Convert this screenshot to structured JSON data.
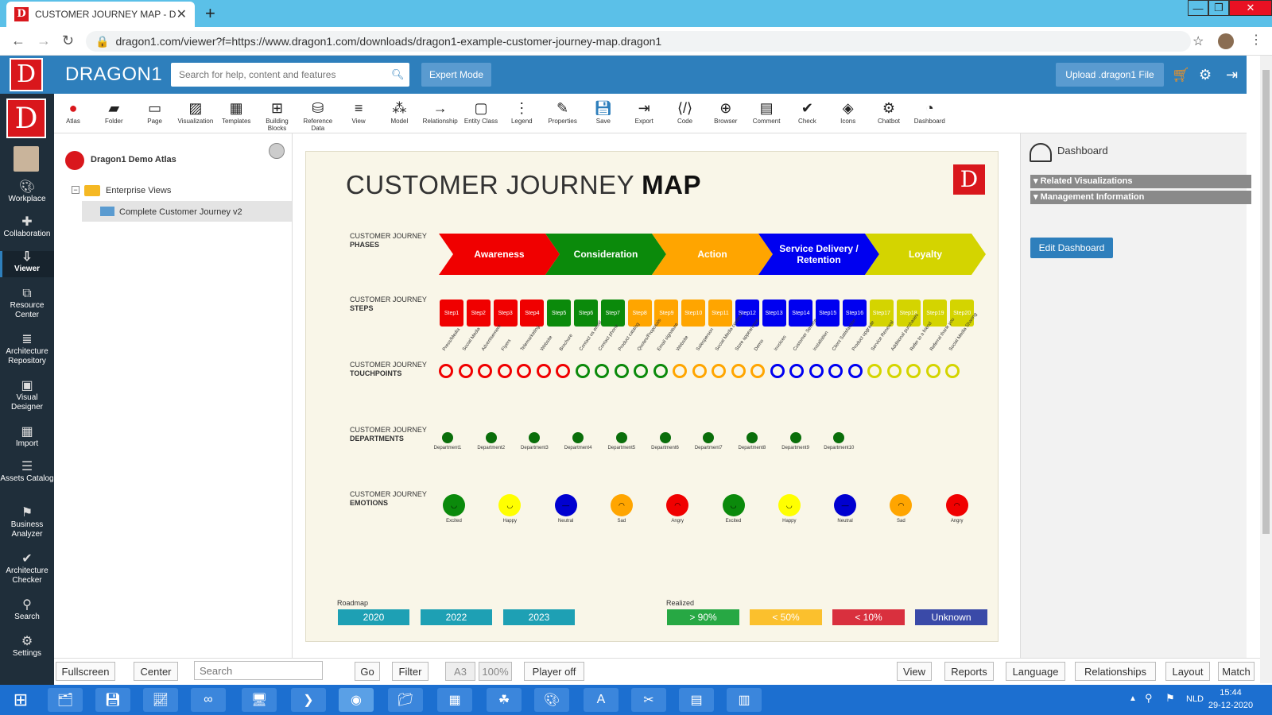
{
  "browser": {
    "tab_title": "CUSTOMER JOURNEY MAP - Dra",
    "url": "dragon1.com/viewer?f=https://www.dragon1.com/downloads/dragon1-example-customer-journey-map.dragon1"
  },
  "header": {
    "brand": "DRAGON1",
    "search_placeholder": "Search for help, content and features",
    "expert_mode": "Expert Mode",
    "upload": "Upload .dragon1 File"
  },
  "left_nav": [
    {
      "label": "Workplace",
      "icon": "palette-icon"
    },
    {
      "label": "Collaboration",
      "icon": "puzzle-icon"
    },
    {
      "label": "Viewer",
      "icon": "viewer-icon"
    },
    {
      "label": "Resource Center",
      "icon": "resource-icon"
    },
    {
      "label": "Architecture Repository",
      "icon": "database-icon"
    },
    {
      "label": "Visual Designer",
      "icon": "image-icon"
    },
    {
      "label": "Import",
      "icon": "table-icon"
    },
    {
      "label": "Assets Catalog",
      "icon": "list-icon"
    },
    {
      "label": "Business Analyzer",
      "icon": "flag-icon"
    },
    {
      "label": "Architecture Checker",
      "icon": "check-icon"
    },
    {
      "label": "Search",
      "icon": "search-icon"
    },
    {
      "label": "Settings",
      "icon": "gear-icon"
    }
  ],
  "toolbar": [
    "Atlas",
    "Folder",
    "Page",
    "Visualization",
    "Templates",
    "Building Blocks",
    "Reference Data",
    "View",
    "Model",
    "Relationship",
    "Entity Class",
    "Legend",
    "Properties",
    "Save",
    "Export",
    "Code",
    "Browser",
    "Comment",
    "Check",
    "Icons",
    "Chatbot",
    "Dashboard"
  ],
  "tree": {
    "atlas": "Dragon1 Demo Atlas",
    "folder": "Enterprise Views",
    "item": "Complete Customer Journey v2"
  },
  "map": {
    "title_light": "CUSTOMER JOURNEY ",
    "title_bold": "MAP",
    "row_prefix": "CUSTOMER JOURNEY",
    "rows": [
      "PHASES",
      "STEPS",
      "TOUCHPOINTS",
      "DEPARTMENTS",
      "EMOTIONS"
    ],
    "phases": [
      {
        "label": "Awareness",
        "color": "#f00000"
      },
      {
        "label": "Consideration",
        "color": "#0b8a0b"
      },
      {
        "label": "Action",
        "color": "#ffa500"
      },
      {
        "label": "Service Delivery / Retention",
        "color": "#0000f0"
      },
      {
        "label": "Loyalty",
        "color": "#d4d400"
      }
    ],
    "steps": [
      "Step1",
      "Step2",
      "Step3",
      "Step4",
      "Step5",
      "Step6",
      "Step7",
      "Step8",
      "Step9",
      "Step10",
      "Step11",
      "Step12",
      "Step13",
      "Step14",
      "Step15",
      "Step16",
      "Step17",
      "Step18",
      "Step19",
      "Step20"
    ],
    "step_colors": [
      "#f00000",
      "#f00000",
      "#f00000",
      "#f00000",
      "#0b8a0b",
      "#0b8a0b",
      "#0b8a0b",
      "#ffa500",
      "#ffa500",
      "#ffa500",
      "#ffa500",
      "#0000f0",
      "#0000f0",
      "#0000f0",
      "#0000f0",
      "#0000f0",
      "#d4d400",
      "#d4d400",
      "#d4d400",
      "#d4d400"
    ],
    "touchpoints": [
      "Press/Media",
      "Social Media",
      "Advertisement",
      "Flyers",
      "Telemarketing",
      "Website",
      "Brochure",
      "Contact us email",
      "Contact phone",
      "Product catalog",
      "Quotes/Proposals",
      "Email signature",
      "Website",
      "Salesperson",
      "Social Media contest",
      "Store appearance",
      "Demo",
      "Invoices",
      "Customer Service",
      "Installation",
      "Client Satisfaction",
      "Product upgrade",
      "Service Renewal",
      "Additional purchases",
      "Refer to a friend",
      "Referral thank you",
      "Social Media Sharing"
    ],
    "touchpoint_colors": [
      "#f00000",
      "#f00000",
      "#f00000",
      "#f00000",
      "#f00000",
      "#f00000",
      "#f00000",
      "#0b8a0b",
      "#0b8a0b",
      "#0b8a0b",
      "#0b8a0b",
      "#0b8a0b",
      "#ffa500",
      "#ffa500",
      "#ffa500",
      "#ffa500",
      "#ffa500",
      "#0000f0",
      "#0000f0",
      "#0000f0",
      "#0000f0",
      "#0000f0",
      "#d4d400",
      "#d4d400",
      "#d4d400",
      "#d4d400",
      "#d4d400"
    ],
    "departments": [
      "Department1",
      "Department2",
      "Department3",
      "Department4",
      "Department5",
      "Department6",
      "Department7",
      "Department8",
      "Department9",
      "Department10"
    ],
    "emotions": [
      {
        "label": "Excited",
        "color": "#0b8a0b"
      },
      {
        "label": "Happy",
        "color": "#ffff00"
      },
      {
        "label": "Neutral",
        "color": "#0000d0"
      },
      {
        "label": "Sad",
        "color": "#ffa500"
      },
      {
        "label": "Angry",
        "color": "#f00000"
      },
      {
        "label": "Excited",
        "color": "#0b8a0b"
      },
      {
        "label": "Happy",
        "color": "#ffff00"
      },
      {
        "label": "Neutral",
        "color": "#0000d0"
      },
      {
        "label": "Sad",
        "color": "#ffa500"
      },
      {
        "label": "Angry",
        "color": "#f00000"
      }
    ],
    "roadmap_label": "Roadmap",
    "roadmap": [
      "2020",
      "2022",
      "2023"
    ],
    "realized_label": "Realized",
    "legend": [
      {
        "label": "> 90%",
        "color": "#27a844"
      },
      {
        "label": "< 50%",
        "color": "#fbc02d"
      },
      {
        "label": "< 10%",
        "color": "#d9303e"
      },
      {
        "label": "Unknown",
        "color": "#3a4aa8"
      }
    ]
  },
  "right_panel": {
    "title": "Dashboard",
    "sections": [
      "Related Visualizations",
      "Management Information"
    ],
    "edit_button": "Edit Dashboard"
  },
  "bottom": {
    "fullscreen": "Fullscreen",
    "center": "Center",
    "search_placeholder": "Search",
    "go": "Go",
    "filter": "Filter",
    "paper": "A3",
    "zoom": "100%",
    "player": "Player off",
    "view": "View",
    "reports": "Reports",
    "language": "Language",
    "relationships": "Relationships",
    "layout": "Layout",
    "match": "Match"
  },
  "taskbar": {
    "lang": "NLD",
    "time": "15:44",
    "date": "29-12-2020"
  }
}
